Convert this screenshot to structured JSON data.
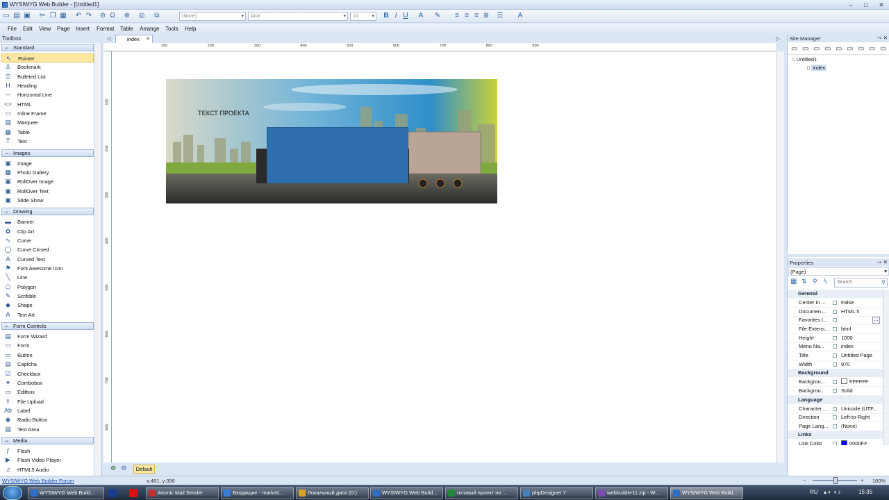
{
  "window": {
    "title": "WYSIWYG Web Builder - [Untitled1]"
  },
  "toolbar": {
    "style_combo": "(None)",
    "font_combo": "Arial",
    "size_combo": "10"
  },
  "menu": [
    "File",
    "Edit",
    "View",
    "Page",
    "Insert",
    "Format",
    "Table",
    "Arrange",
    "Tools",
    "Help"
  ],
  "toolbox": {
    "title": "Toolbox",
    "categories": [
      {
        "name": "Standard",
        "items": [
          "Pointer",
          "Bookmark",
          "Bulleted List",
          "Heading",
          "Horizontal Line",
          "HTML",
          "Inline Frame",
          "Marquee",
          "Table",
          "Text"
        ]
      },
      {
        "name": "Images",
        "items": [
          "Image",
          "Photo Gallery",
          "RollOver Image",
          "RollOver Text",
          "Slide Show"
        ]
      },
      {
        "name": "Drawing",
        "items": [
          "Banner",
          "Clip Art",
          "Curve",
          "Curve Closed",
          "Curved Text",
          "Font Awesome Icon",
          "Line",
          "Polygon",
          "Scribble",
          "Shape",
          "Text Art"
        ]
      },
      {
        "name": "Form Controls",
        "items": [
          "Form Wizard",
          "Form",
          "Button",
          "Captcha",
          "Checkbox",
          "Combobox",
          "Editbox",
          "File Upload",
          "Label",
          "Radio Button",
          "Text Area"
        ]
      },
      {
        "name": "Media",
        "items": [
          "Flash",
          "Flash Video Player",
          "HTML5 Audio"
        ]
      }
    ]
  },
  "editor": {
    "tab": "index",
    "ruler_h": [
      "100",
      "200",
      "300",
      "400",
      "500",
      "600",
      "700",
      "800",
      "900"
    ],
    "ruler_v": [
      "100",
      "200",
      "300",
      "400",
      "500",
      "600",
      "700",
      "800"
    ],
    "hero_text": "ТЕКСТ ПРОЕКТА",
    "master_page": "Default"
  },
  "site_manager": {
    "title": "Site Manager",
    "root": "Untitled1",
    "page": "index"
  },
  "properties": {
    "title": "Properties",
    "selector": "(Page)",
    "search_placeholder": "Search",
    "sections": [
      {
        "name": "General",
        "rows": [
          [
            "Center in ...",
            "False"
          ],
          [
            "Documen...",
            "HTML 5"
          ],
          [
            "Favorites I...",
            ""
          ],
          [
            "File Extens...",
            "html"
          ],
          [
            "Height",
            "1000"
          ],
          [
            "Menu Na...",
            "index"
          ],
          [
            "Title",
            "Untitled Page"
          ],
          [
            "Width",
            "970"
          ]
        ]
      },
      {
        "name": "Background",
        "rows": [
          [
            "Backgrou...",
            "FFFFFF"
          ],
          [
            "Backgrou...",
            "Solid"
          ]
        ]
      },
      {
        "name": "Language",
        "rows": [
          [
            "Character ...",
            "Unicode (UTF..."
          ],
          [
            "Direction",
            "Left-to-Right"
          ],
          [
            "Page Lang...",
            "(None)"
          ]
        ]
      },
      {
        "name": "Links",
        "rows": [
          [
            "Link Color",
            "0000FF"
          ]
        ]
      }
    ]
  },
  "status": {
    "link": "WYSIWYG Web Builder Forum",
    "coords": "x:481, y:396",
    "zoom": "100%"
  },
  "taskbar": {
    "items": [
      "WYSIWYG Web Build...",
      "Atomic Mail Sender",
      "Входящие - marketi...",
      "Локальный диск (D:)",
      "WYSIWYG Web Build...",
      "готовый проект по ...",
      "phpDesigner 7",
      "webbuilder11.zip - W...",
      "WYSIWYG Web Build..."
    ],
    "lang": "RU",
    "clock": "15:35"
  },
  "colors": {
    "accent_blue": "#2f6fb0",
    "selection": "#fde7a3",
    "link_color": "#0000FF"
  }
}
